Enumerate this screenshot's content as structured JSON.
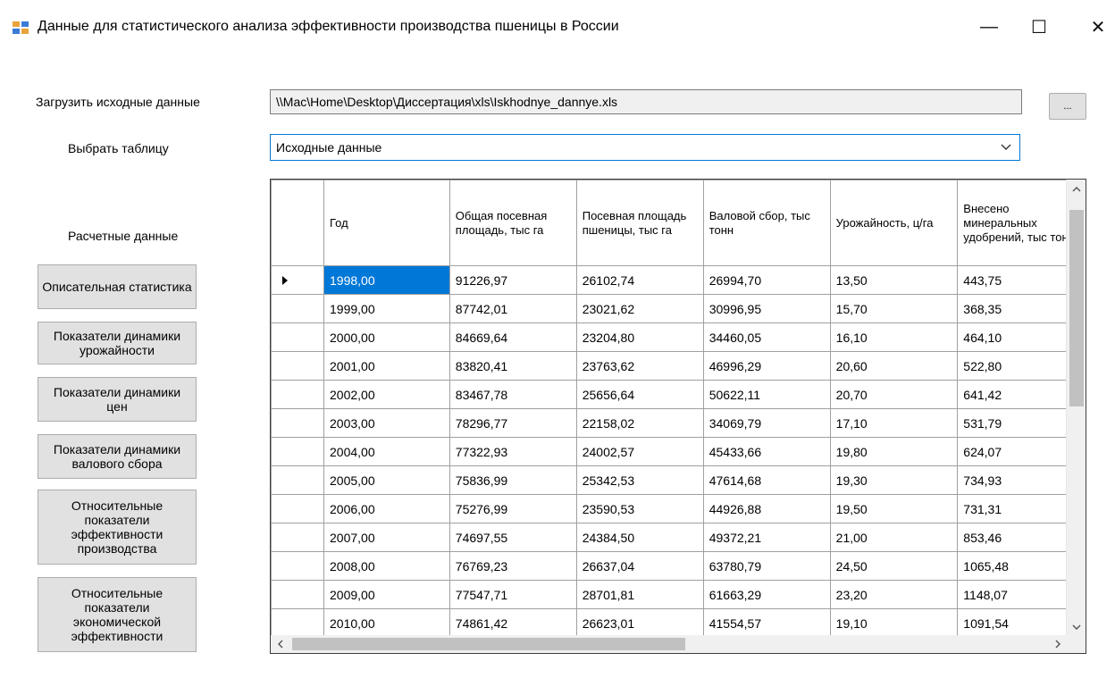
{
  "window": {
    "title": "Данные для статистического анализа эффективности производства пшеницы в России",
    "controls": {
      "minimize": "—",
      "maximize": "☐",
      "close": "✕"
    },
    "icon": "app-window-icon"
  },
  "source": {
    "label": "Загрузить исходные данные",
    "path": "\\\\Mac\\Home\\Desktop\\Диссертация\\xls\\Iskhodnye_dannye.xls",
    "browse_label": "..."
  },
  "table_select": {
    "label": "Выбрать таблицу",
    "selected": "Исходные данные"
  },
  "calc": {
    "label": "Расчетные данные",
    "buttons": [
      "Описательная статистика",
      "Показатели динамики урожайности",
      "Показатели динамики цен",
      "Показатели динамики валового сбора",
      "Относительные показатели эффективности производства",
      "Относительные показатели экономической эффективности"
    ]
  },
  "grid": {
    "columns": [
      "Год",
      "Общая посевная площадь, тыс га",
      "Посевная площадь пшеницы, тыс га",
      "Валовой сбор, тыс тонн",
      "Урожайность, ц/га",
      "Внесено минеральных удобрений, тыс тонн"
    ],
    "rows": [
      [
        "1998,00",
        "91226,97",
        "26102,74",
        "26994,70",
        "13,50",
        "443,75"
      ],
      [
        "1999,00",
        "87742,01",
        "23021,62",
        "30996,95",
        "15,70",
        "368,35"
      ],
      [
        "2000,00",
        "84669,64",
        "23204,80",
        "34460,05",
        "16,10",
        "464,10"
      ],
      [
        "2001,00",
        "83820,41",
        "23763,62",
        "46996,29",
        "20,60",
        "522,80"
      ],
      [
        "2002,00",
        "83467,78",
        "25656,64",
        "50622,11",
        "20,70",
        "641,42"
      ],
      [
        "2003,00",
        "78296,77",
        "22158,02",
        "34069,79",
        "17,10",
        "531,79"
      ],
      [
        "2004,00",
        "77322,93",
        "24002,57",
        "45433,66",
        "19,80",
        "624,07"
      ],
      [
        "2005,00",
        "75836,99",
        "25342,53",
        "47614,68",
        "19,30",
        "734,93"
      ],
      [
        "2006,00",
        "75276,99",
        "23590,53",
        "44926,88",
        "19,50",
        "731,31"
      ],
      [
        "2007,00",
        "74697,55",
        "24384,50",
        "49372,21",
        "21,00",
        "853,46"
      ],
      [
        "2008,00",
        "76769,23",
        "26637,04",
        "63780,79",
        "24,50",
        "1065,48"
      ],
      [
        "2009,00",
        "77547,71",
        "28701,81",
        "61663,29",
        "23,20",
        "1148,07"
      ],
      [
        "2010,00",
        "74861,42",
        "26623,01",
        "41554,57",
        "19,10",
        "1091,54"
      ]
    ]
  }
}
